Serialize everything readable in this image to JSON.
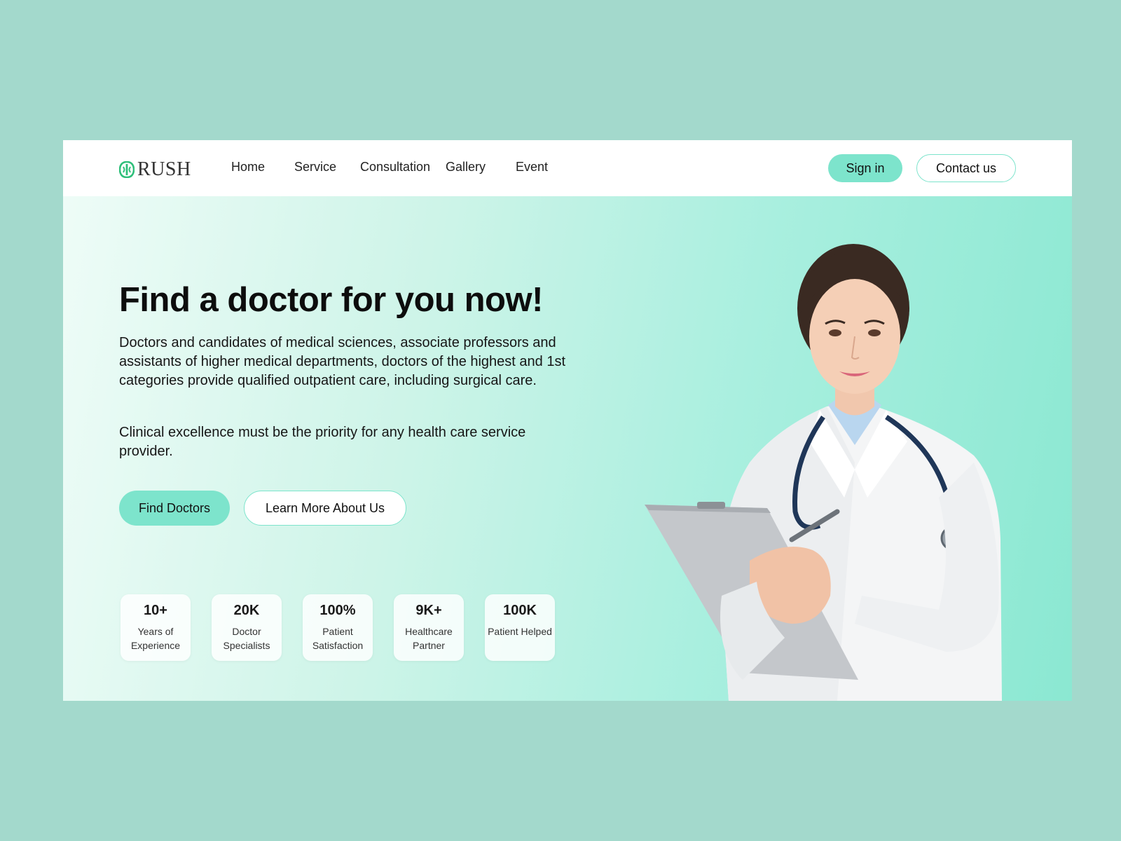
{
  "brand": {
    "name": "RUSH",
    "accent": "#7de4cc",
    "logo_color": "#2fbf7a"
  },
  "nav": {
    "items": [
      {
        "label": "Home"
      },
      {
        "label": "Service"
      },
      {
        "label": "Consultation"
      },
      {
        "label": "Gallery"
      },
      {
        "label": "Event"
      }
    ],
    "sign_in": "Sign in",
    "contact": "Contact us"
  },
  "hero": {
    "title": "Find a doctor for you now!",
    "paragraph1": "Doctors and candidates of medical sciences, associate professors and assistants of higher medical departments, doctors of the highest and 1st categories provide qualified outpatient care, including surgical care.",
    "paragraph2": "Clinical excellence must be the priority for any health care service provider.",
    "primary_cta": "Find Doctors",
    "secondary_cta": "Learn More About Us"
  },
  "stats": [
    {
      "value": "10+",
      "label": "Years of Experience"
    },
    {
      "value": "20K",
      "label": "Doctor Specialists"
    },
    {
      "value": "100%",
      "label": "Patient Satisfaction"
    },
    {
      "value": "9K+",
      "label": "Healthcare Partner"
    },
    {
      "value": "100K",
      "label": "Patient Helped"
    }
  ]
}
